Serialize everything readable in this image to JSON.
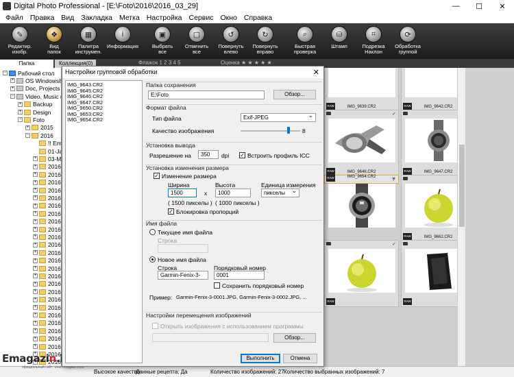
{
  "window": {
    "title": "Digital Photo Professional - [E:\\Foto\\2016\\2016_03_29]",
    "min": "—",
    "max": "☐",
    "close": "✕"
  },
  "menu": [
    "Файл",
    "Правка",
    "Вид",
    "Закладка",
    "Метка",
    "Настройка",
    "Сервис",
    "Окно",
    "Справка"
  ],
  "toolbar": [
    {
      "label": "Редактир.\nизобр.",
      "icon": "edit-image-icon",
      "glyph": "✎"
    },
    {
      "label": "Вид\nпапок",
      "icon": "folder-view-icon",
      "glyph": "❖",
      "active": true
    },
    {
      "label": "Палитра\nинструмен.",
      "icon": "palette-icon",
      "glyph": "▦"
    },
    {
      "label": "Информация",
      "icon": "info-icon",
      "glyph": "i"
    },
    {
      "label": "Выбрать\nвсе",
      "icon": "select-all-icon",
      "glyph": "▣"
    },
    {
      "label": "Отменить\nвсе",
      "icon": "deselect-all-icon",
      "glyph": "▢"
    },
    {
      "label": "Повернуть\nвлево",
      "icon": "rotate-left-icon",
      "glyph": "↺"
    },
    {
      "label": "Повернуть\nвправо",
      "icon": "rotate-right-icon",
      "glyph": "↻"
    },
    {
      "label": "Быстрая\nпроверка",
      "icon": "quick-check-icon",
      "glyph": "⌕"
    },
    {
      "label": "Штамп",
      "icon": "stamp-icon",
      "glyph": "⛁"
    },
    {
      "label": "Подрезка\nНаклон",
      "icon": "crop-icon",
      "glyph": "⌗"
    },
    {
      "label": "Обработка\nгруппой",
      "icon": "batch-process-icon",
      "glyph": "⟳"
    }
  ],
  "tabs": {
    "folder": "Папка",
    "collection": "Коллекция(0)"
  },
  "flag": {
    "label": "Флажок",
    "values": "1 2 3 4 5"
  },
  "rating": {
    "label": "Оценка",
    "stars": "★ ★ ★ ★ ★"
  },
  "tree": [
    {
      "text": "Рабочий стол",
      "indent": 0,
      "exp": "−",
      "kind": "blue"
    },
    {
      "text": "OS Windows8 (",
      "indent": 1,
      "exp": "+",
      "kind": "gray"
    },
    {
      "text": "Doc, Projects (D",
      "indent": 1,
      "exp": "+",
      "kind": "gray"
    },
    {
      "text": "Video, Music (E",
      "indent": 1,
      "exp": "−",
      "kind": "gray"
    },
    {
      "text": "Backup",
      "indent": 2,
      "exp": "+",
      "kind": "folder"
    },
    {
      "text": "Design",
      "indent": 2,
      "exp": "+",
      "kind": "folder"
    },
    {
      "text": "Foto",
      "indent": 2,
      "exp": "−",
      "kind": "folder"
    },
    {
      "text": "2015",
      "indent": 3,
      "exp": "+",
      "kind": "folder"
    },
    {
      "text": "2016",
      "indent": 3,
      "exp": "−",
      "kind": "folder"
    },
    {
      "text": "!! Em",
      "indent": 4,
      "exp": "",
      "kind": "folder"
    },
    {
      "text": "01-Ja",
      "indent": 4,
      "exp": "",
      "kind": "folder"
    },
    {
      "text": "03-M",
      "indent": 4,
      "exp": "+",
      "kind": "folder"
    },
    {
      "text": "2016",
      "indent": 4,
      "exp": "+",
      "kind": "folder"
    },
    {
      "text": "2016",
      "indent": 4,
      "exp": "+",
      "kind": "folder"
    },
    {
      "text": "2016",
      "indent": 4,
      "exp": "+",
      "kind": "folder"
    },
    {
      "text": "2016",
      "indent": 4,
      "exp": "+",
      "kind": "folder"
    },
    {
      "text": "2016",
      "indent": 4,
      "exp": "+",
      "kind": "folder"
    },
    {
      "text": "2016",
      "indent": 4,
      "exp": "+",
      "kind": "folder"
    },
    {
      "text": "2016",
      "indent": 4,
      "exp": "+",
      "kind": "folder"
    },
    {
      "text": "2016",
      "indent": 4,
      "exp": "+",
      "kind": "folder"
    },
    {
      "text": "2016",
      "indent": 4,
      "exp": "+",
      "kind": "folder"
    },
    {
      "text": "2016",
      "indent": 4,
      "exp": "+",
      "kind": "folder"
    },
    {
      "text": "2016",
      "indent": 4,
      "exp": "+",
      "kind": "folder"
    },
    {
      "text": "2016",
      "indent": 4,
      "exp": "+",
      "kind": "folder"
    },
    {
      "text": "2016",
      "indent": 4,
      "exp": "+",
      "kind": "folder"
    },
    {
      "text": "2016",
      "indent": 4,
      "exp": "+",
      "kind": "folder"
    },
    {
      "text": "2016",
      "indent": 4,
      "exp": "+",
      "kind": "folder"
    },
    {
      "text": "2016",
      "indent": 4,
      "exp": "+",
      "kind": "folder"
    },
    {
      "text": "2016",
      "indent": 4,
      "exp": "+",
      "kind": "folder"
    },
    {
      "text": "2016",
      "indent": 4,
      "exp": "+",
      "kind": "folder"
    },
    {
      "text": "2016",
      "indent": 4,
      "exp": "+",
      "kind": "folder"
    },
    {
      "text": "2016",
      "indent": 4,
      "exp": "+",
      "kind": "folder"
    },
    {
      "text": "2016",
      "indent": 4,
      "exp": "+",
      "kind": "folder"
    },
    {
      "text": "2016",
      "indent": 4,
      "exp": "+",
      "kind": "folder"
    },
    {
      "text": "2016",
      "indent": 4,
      "exp": "+",
      "kind": "folder"
    },
    {
      "text": "2016",
      "indent": 4,
      "exp": "+",
      "kind": "folder"
    },
    {
      "text": "2016",
      "indent": 4,
      "exp": "+",
      "kind": "folder"
    },
    {
      "text": "2016",
      "indent": 4,
      "exp": "+",
      "kind": "folder"
    }
  ],
  "thumbnails": [
    {
      "name": "IMG_9639.CR2",
      "photo": "blank"
    },
    {
      "name": "IMG_9642.CR2",
      "photo": "blank"
    },
    {
      "name": "IMG_9646.CR2",
      "photo": "watch-side"
    },
    {
      "name": "IMG_9647.CR2",
      "photo": "watch-front"
    },
    {
      "name": "IMG_9654.CR2",
      "photo": "watch-face",
      "selected": true
    },
    {
      "name": "IMG_9662.CR2",
      "photo": "apple"
    },
    {
      "name": "",
      "photo": "apple"
    },
    {
      "name": "",
      "photo": "case"
    }
  ],
  "status": {
    "quality": "Высокое качество",
    "recipe": "Данные рецепта: Да",
    "count": "Количество изображений: 27",
    "selected": "Количество выбранных изображений: 7"
  },
  "logo": {
    "main": "Emagazi",
    "accent": "n",
    "tail": ".info",
    "sub": "официальный сайт: www.emagazin.info"
  },
  "dialog": {
    "title": "Настройки групповой обработки",
    "close": "✕",
    "files": [
      "IMG_9643.CR2",
      "IMG_9645.CR2",
      "IMG_9646.CR2",
      "IMG_9647.CR2",
      "IMG_9650.CR2",
      "IMG_9653.CR2",
      "IMG_9654.CR2"
    ],
    "save": {
      "group": "Папка сохранения",
      "path": "E:\\Foto",
      "browse": "Обзор..."
    },
    "format": {
      "group": "Формат файла",
      "type_label": "Тип файла",
      "type_value": "Exif-JPEG",
      "quality_label": "Качество изображения",
      "quality_value": "8",
      "quality_fraction": 0.8
    },
    "output": {
      "group": "Установка вывода",
      "res_label": "Разрешение на",
      "res_value": "350",
      "res_unit": "dpi",
      "icc_label": "Встроить профиль ICC",
      "icc_checked": true
    },
    "resize": {
      "group": "Установка изменения размера",
      "enable_label": "Изменение размера",
      "enable_checked": true,
      "width_label": "Ширина",
      "width_value": "1500",
      "width_hint": "( 1500 пикселы )",
      "times": "x",
      "height_label": "Высота",
      "height_value": "1000",
      "height_hint": "( 1000 пикселы )",
      "unit_label": "Единица измерения",
      "unit_value": "пикселы",
      "lock_label": "Блокировка пропорций",
      "lock_checked": true
    },
    "filename": {
      "group": "Имя файла",
      "current_label": "Текущее имя файла",
      "string_label_dim": "Строка",
      "new_label": "Новое имя файла",
      "string_label": "Строка",
      "string_value": "Garmin-Fenix-3-",
      "serial_label": "Порядковый номер",
      "serial_value": "0001",
      "keep_serial_label": "Сохранить порядковый номер",
      "example_label": "Пример:",
      "example_value": "Garmin-Fenix-3-0001.JPG, Garmin-Fenix-3-0002.JPG, ..."
    },
    "transfer": {
      "group": "Настройки перемещения изображений",
      "open_label": "Открыть изображения с использованием программы",
      "browse": "Обзор..."
    },
    "run": "Выполнить",
    "cancel": "Отмена"
  }
}
